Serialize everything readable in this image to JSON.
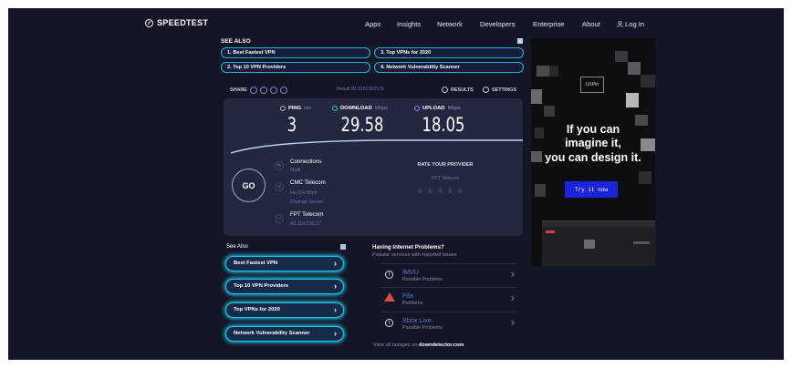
{
  "header": {
    "logo": "SPEEDTEST",
    "nav": [
      "Apps",
      "Insights",
      "Network",
      "Developers",
      "Enterprise",
      "About"
    ],
    "login": "Log In"
  },
  "see_also_top": {
    "title": "SEE ALSO",
    "links": [
      "1. Best Fastest VPN",
      "3. Top VPNs for 2020",
      "2. Top 10 VPN Providers",
      "4. Network Vulnerability Scanner"
    ]
  },
  "toolbar": {
    "share_label": "SHARE",
    "result_id_label": "Result ID",
    "result_id_value": "9160382579",
    "results_label": "RESULTS",
    "settings_label": "SETTINGS"
  },
  "metrics": {
    "ping": {
      "label": "PING",
      "unit": "ms",
      "value": "3"
    },
    "download": {
      "label": "DOWNLOAD",
      "unit": "Mbps",
      "value": "29.58"
    },
    "upload": {
      "label": "UPLOAD",
      "unit": "Mbps",
      "value": "18.05"
    }
  },
  "go_label": "GO",
  "connection": {
    "connections_title": "Connections",
    "connections_sub": "Multi",
    "server_title": "CMC Telecom",
    "server_location": "Ho Chi Minh",
    "change_server": "Change Server",
    "isp_title": "FPT Telecom",
    "isp_ip": "42.119.230.27"
  },
  "rate": {
    "title": "RATE YOUR PROVIDER",
    "provider": "FPT Telecom",
    "stars": "★★★★★"
  },
  "see_also_bottom": {
    "title": "See Also",
    "links": [
      "Best Fastest VPN",
      "Top 10 VPN Providers",
      "Top VPNs for 2020",
      "Network Vulnerability Scanner"
    ]
  },
  "problems": {
    "title": "Having Internet Problems?",
    "subtitle": "Popular services with reported issues",
    "services": [
      {
        "name": "IMVU",
        "status": "Possible Problems",
        "icon": "info-icon"
      },
      {
        "name": "Fifa",
        "status": "Problems",
        "icon": "warning-icon"
      },
      {
        "name": "Xbox Live",
        "status": "Possible Problems",
        "icon": "info-icon"
      }
    ],
    "outage_prefix": "View all outages on",
    "outage_site": "downdetector.com"
  },
  "ad": {
    "logo": "UXPin",
    "line1": "If you can",
    "line2": "imagine it,",
    "line3": "you can design it.",
    "button": "Try it now"
  },
  "colors": {
    "background": "#141526",
    "panel": "#242740",
    "accent_cyan": "#1cc7e8",
    "link_blue": "#5b6bd4",
    "ad_button": "#1a24d8"
  }
}
